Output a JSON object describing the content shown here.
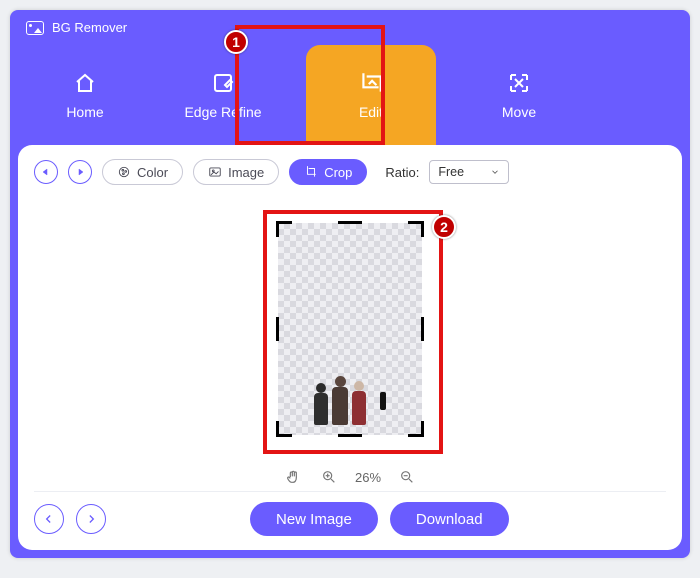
{
  "app": {
    "title": "BG Remover"
  },
  "tabs": {
    "home": "Home",
    "edge": "Edge Refine",
    "edit": "Edit",
    "move": "Move",
    "active": "edit"
  },
  "toolbar": {
    "color": "Color",
    "image": "Image",
    "crop": "Crop",
    "ratio_label": "Ratio:",
    "ratio_value": "Free"
  },
  "zoom": {
    "value": "26%"
  },
  "footer": {
    "new_image": "New Image",
    "download": "Download"
  },
  "annotations": {
    "marker1": "1",
    "marker2": "2"
  }
}
